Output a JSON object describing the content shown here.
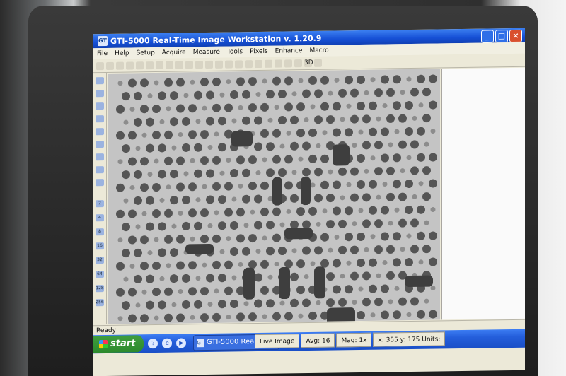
{
  "window": {
    "title": "GTI-5000 Real-Time Image Workstation  v.  1.20.9",
    "icon_text": "GT",
    "buttons": [
      "minimize",
      "maximize",
      "close"
    ]
  },
  "menu": [
    "File",
    "Help",
    "Setup",
    "Acquire",
    "Measure",
    "Tools",
    "Pixels",
    "Enhance",
    "Macro"
  ],
  "toolbar": [
    "T",
    "3D"
  ],
  "left_tools": [
    "2",
    "4",
    "8",
    "16",
    "32",
    "64",
    "128",
    "256"
  ],
  "status": {
    "text": "Ready"
  },
  "measure": {
    "mode": "Live Image",
    "avg": "Avg: 16",
    "mag": "Mag: 1x",
    "coords": "x: 355  y: 175  Units:"
  },
  "taskbar": {
    "start": "start",
    "item": "GTI-5000 Real-Time I..."
  }
}
